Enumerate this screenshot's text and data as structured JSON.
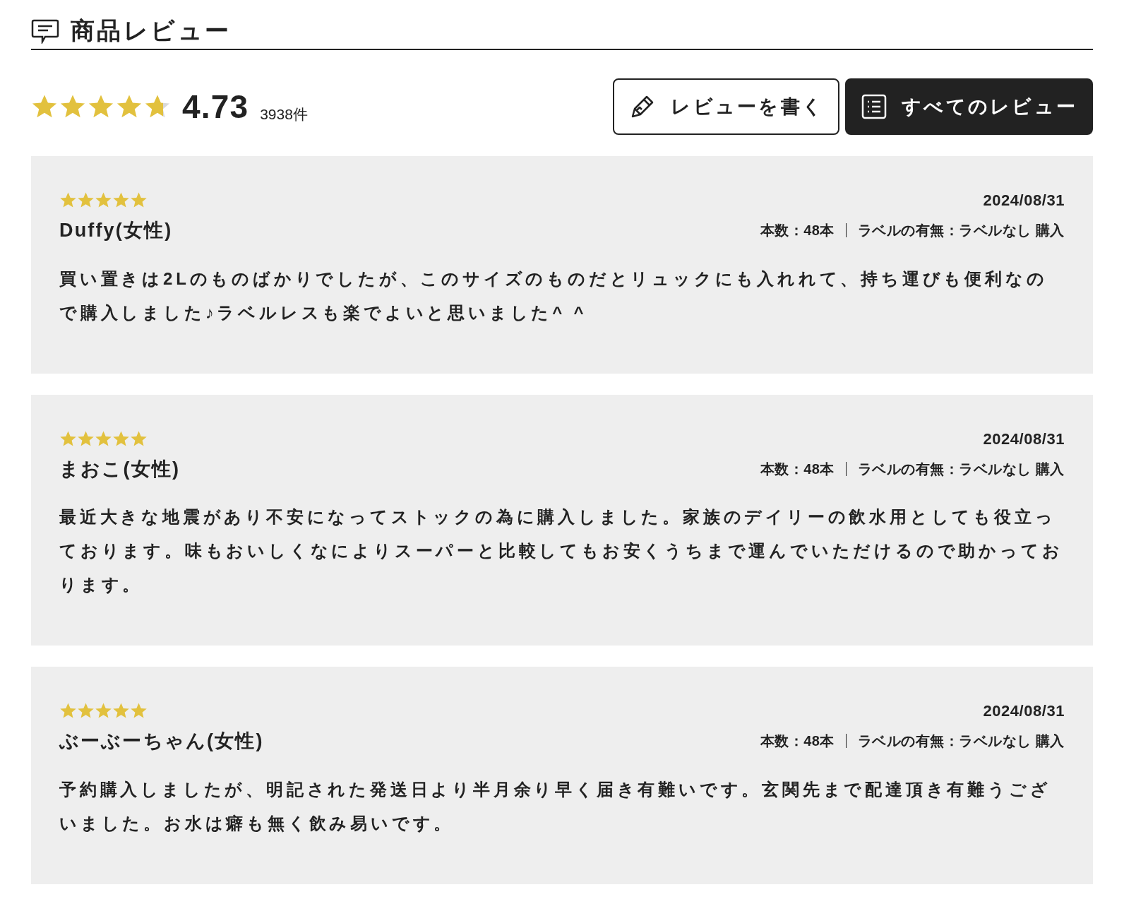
{
  "heading": "商品レビュー",
  "summary": {
    "stars": 4.73,
    "score": "4.73",
    "count": "3938件"
  },
  "buttons": [
    {
      "label": "レビューを書く",
      "kind": "write"
    },
    {
      "label": "すべてのレビュー",
      "kind": "all"
    }
  ],
  "reviews": [
    {
      "stars": 5,
      "date": "2024/08/31",
      "author": "Duffy(女性)",
      "meta": [
        "本数：48本",
        "ラベルの有無：ラベルなし 購入"
      ],
      "body": "買い置きは2Lのものばかりでしたが、このサイズのものだとリュックにも入れれて、持ち運びも便利なので購入しました♪ラベルレスも楽でよいと思いました^ ^"
    },
    {
      "stars": 5,
      "date": "2024/08/31",
      "author": "まおこ(女性)",
      "meta": [
        "本数：48本",
        "ラベルの有無：ラベルなし 購入"
      ],
      "body": "最近大きな地震があり不安になってストックの為に購入しました。家族のデイリーの飲水用としても役立っております。味もおいしくなによりスーパーと比較してもお安くうちまで運んでいただけるので助かっております。"
    },
    {
      "stars": 5,
      "date": "2024/08/31",
      "author": "ぶーぶーちゃん(女性)",
      "meta": [
        "本数：48本",
        "ラベルの有無：ラベルなし 購入"
      ],
      "body": "予約購入しましたが、明記された発送日より半月余り早く届き有難いです。玄関先まで配達頂き有難うございました。お水は癖も無く飲み易いです。"
    }
  ]
}
